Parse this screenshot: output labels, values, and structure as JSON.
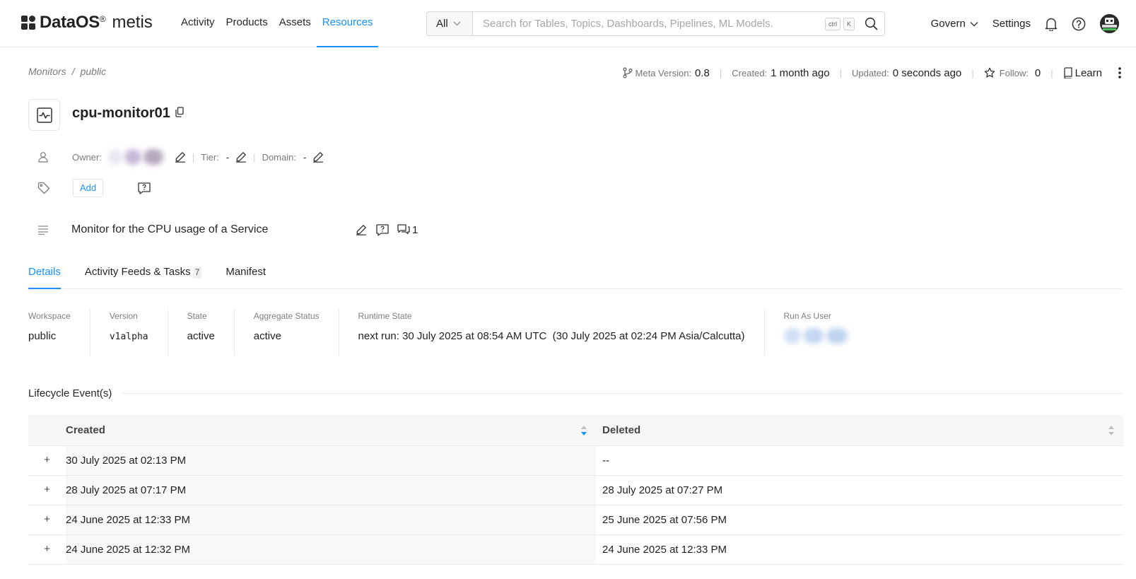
{
  "brand": {
    "name": "DataOS",
    "suffix": "metis"
  },
  "nav": {
    "links": [
      "Activity",
      "Products",
      "Assets",
      "Resources"
    ],
    "active": "Resources"
  },
  "search": {
    "scope": "All",
    "placeholder": "Search for Tables, Topics, Dashboards, Pipelines, ML Models.",
    "kbd_1": "ctrl",
    "kbd_2": "K"
  },
  "nav_right": {
    "govern": "Govern",
    "settings": "Settings"
  },
  "breadcrumb": {
    "root": "Monitors",
    "separator": "/",
    "current": "public"
  },
  "meta": {
    "version_label": "Meta Version:",
    "version_value": "0.8",
    "created_label": "Created:",
    "created_value": "1 month ago",
    "updated_label": "Updated:",
    "updated_value": "0 seconds ago",
    "follow_label": "Follow:",
    "follow_value": "0",
    "learn": "Learn"
  },
  "entity": {
    "title": "cpu-monitor01",
    "owner_label": "Owner:",
    "tier_label": "Tier:",
    "tier_value": "-",
    "domain_label": "Domain:",
    "domain_value": "-",
    "add_tag": "Add",
    "description": "Monitor for the CPU usage of a Service",
    "comment_count": "1"
  },
  "tabs": [
    {
      "label": "Details"
    },
    {
      "label": "Activity Feeds & Tasks",
      "count": "7"
    },
    {
      "label": "Manifest"
    }
  ],
  "details": {
    "workspace_label": "Workspace",
    "workspace": "public",
    "version_label": "Version",
    "version": "v1alpha",
    "state_label": "State",
    "state": "active",
    "aggregate_label": "Aggregate Status",
    "aggregate": "active",
    "runtime_label": "Runtime State",
    "runtime": "next run: 30 July 2025 at 08:54 AM UTC  (30 July 2025 at 02:24 PM Asia/Calcutta)",
    "run_as_label": "Run As User"
  },
  "lifecycle": {
    "title": "Lifecycle Event(s)",
    "columns": [
      "Created",
      "Deleted"
    ],
    "rows": [
      [
        "30 July 2025 at 02:13 PM",
        "--"
      ],
      [
        "28 July 2025 at 07:17 PM",
        "28 July 2025 at 07:27 PM"
      ],
      [
        "24 June 2025 at 12:33 PM",
        "25 June 2025 at 07:56 PM"
      ],
      [
        "24 June 2025 at 12:32 PM",
        "24 June 2025 at 12:33 PM"
      ]
    ]
  },
  "colors": {
    "accent": "#1890ff",
    "text": "#1f1f1f",
    "muted": "#7a7a7a"
  },
  "icons": [
    "logo-mark",
    "chevron-down-icon",
    "search-icon",
    "bell-icon",
    "help-icon",
    "avatar",
    "branch-icon",
    "star-icon",
    "book-icon",
    "more-vertical-icon",
    "monitor-icon",
    "copy-icon",
    "user-icon",
    "edit-icon",
    "tag-icon",
    "request-icon",
    "lines-icon",
    "comment-icon",
    "plus-icon",
    "sort-icon"
  ]
}
